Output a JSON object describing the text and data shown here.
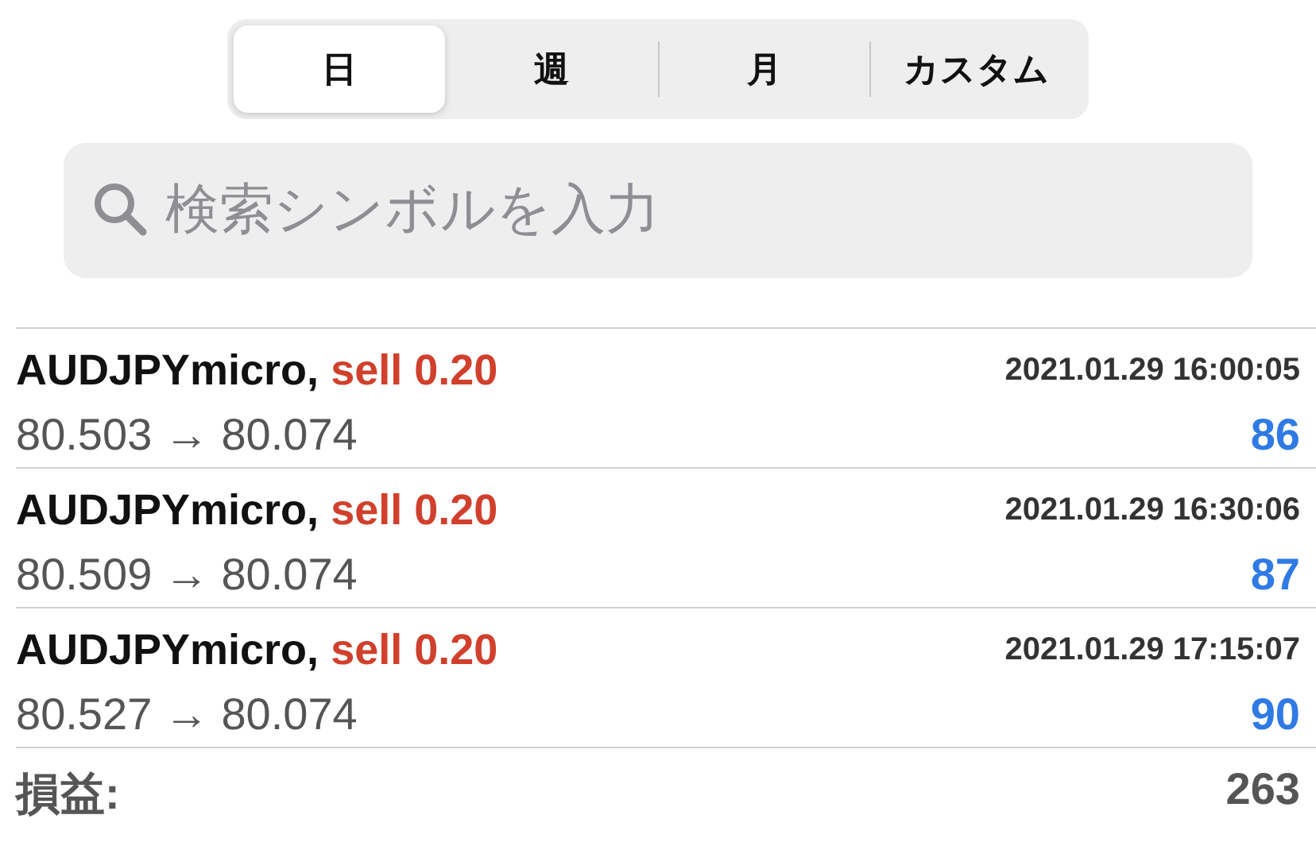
{
  "tabs": [
    {
      "label": "日",
      "selected": true
    },
    {
      "label": "週",
      "selected": false
    },
    {
      "label": "月",
      "selected": false
    },
    {
      "label": "カスタム",
      "selected": false
    }
  ],
  "search": {
    "placeholder": "検索シンボルを入力"
  },
  "trades": [
    {
      "symbol": "AUDJPYmicro,",
      "order": "sell 0.20",
      "time": "2021.01.29 16:00:05",
      "prices": "80.503 → 80.074",
      "profit": "86"
    },
    {
      "symbol": "AUDJPYmicro,",
      "order": "sell 0.20",
      "time": "2021.01.29 16:30:06",
      "prices": "80.509 → 80.074",
      "profit": "87"
    },
    {
      "symbol": "AUDJPYmicro,",
      "order": "sell 0.20",
      "time": "2021.01.29 17:15:07",
      "prices": "80.527 → 80.074",
      "profit": "90"
    }
  ],
  "summary": {
    "label": "損益:",
    "value": "263"
  }
}
